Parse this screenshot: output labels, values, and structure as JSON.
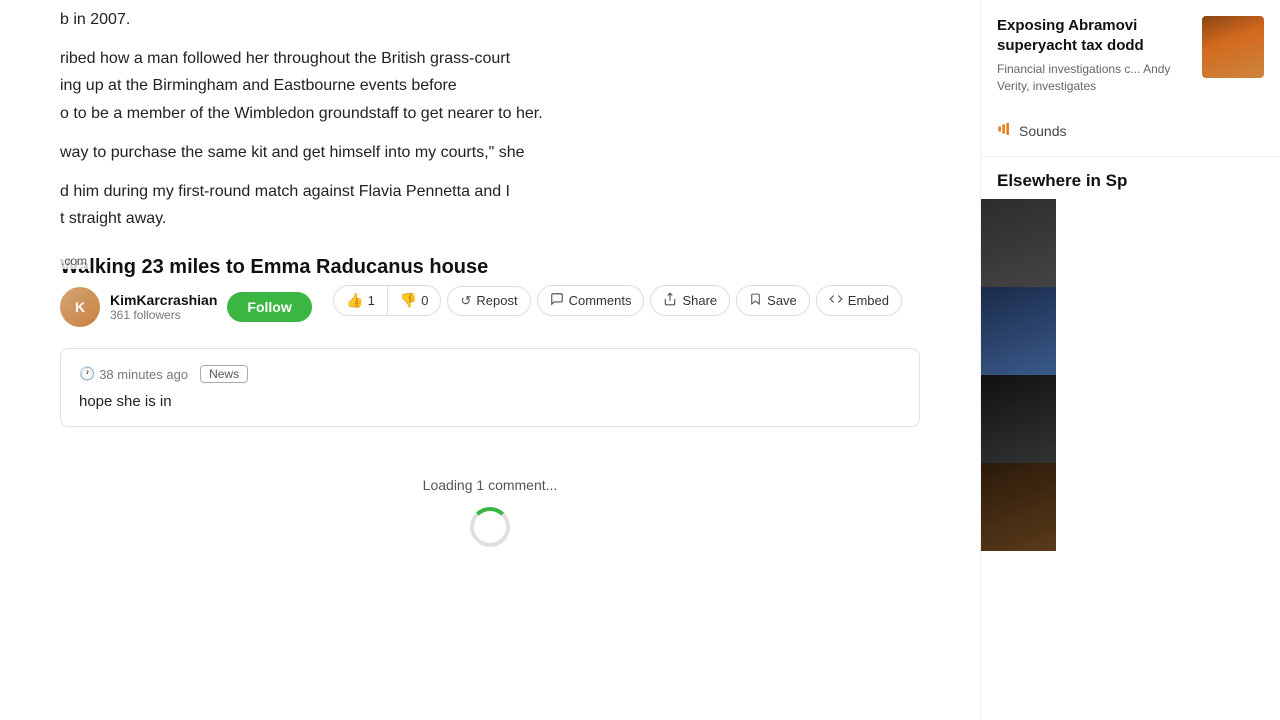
{
  "scrollbar": {
    "visible": true
  },
  "article": {
    "paragraphs": [
      "b in 2007.",
      "ribed how a man followed her throughout the British grass-court\ning up at the Birmingham and Eastbourne events before\no to be a member of the Wimbledon groundstaff to get nearer to her.",
      "way to purchase the same kit and get himself into my courts,\" she",
      "d him during my first-round match against Flavia Pennetta and I\nt straight away."
    ],
    "watermark": ".com"
  },
  "post": {
    "title": "Walking 23 miles to Emma Raducanus house",
    "author": {
      "name": "KimKarcrashian",
      "followers": "361 followers",
      "avatar_letter": "K"
    },
    "follow_label": "Follow",
    "upvotes": "1",
    "downvotes": "0",
    "actions": [
      {
        "id": "repost",
        "label": "Repost",
        "icon": "↺"
      },
      {
        "id": "comments",
        "label": "Comments",
        "icon": "💬"
      },
      {
        "id": "share",
        "label": "Share",
        "icon": "⬆"
      },
      {
        "id": "save",
        "label": "Save",
        "icon": "🔖"
      },
      {
        "id": "embed",
        "label": "Embed",
        "icon": "<>"
      }
    ]
  },
  "comment": {
    "time": "38 minutes ago",
    "badge": "News",
    "text": "hope she is in"
  },
  "loading": {
    "text": "Loading 1 comment..."
  },
  "sidebar": {
    "featured": {
      "title": "Exposing Abramovi superyacht tax dodd",
      "description": "Financial investigations c... Andy Verity, investigates"
    },
    "sounds_label": "Sounds",
    "elsewhere_label": "Elsewhere in Sp",
    "thumb_items": [
      {
        "id": 1,
        "color_class": "thumb-person1"
      },
      {
        "id": 2,
        "color_class": "thumb-person2"
      },
      {
        "id": 3,
        "color_class": "thumb-person3"
      },
      {
        "id": 4,
        "color_class": "thumb-person4"
      },
      {
        "id": 5,
        "color_class": "thumb-person5"
      }
    ]
  },
  "colors": {
    "follow_btn": "#3cb642",
    "spinner": "#3cb642",
    "sounds_icon": "#e67e22"
  }
}
